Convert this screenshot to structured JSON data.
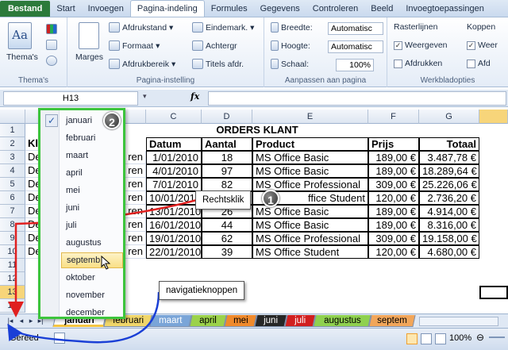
{
  "ribbon_tabs": [
    "Bestand",
    "Start",
    "Invoegen",
    "Pagina-indeling",
    "Formules",
    "Gegevens",
    "Controleren",
    "Beeld",
    "Invoegtoepassingen"
  ],
  "ribbon": {
    "themas": {
      "label": "Thema's",
      "group": "Thema's"
    },
    "marges": "Marges",
    "afdrukstand": "Afdrukstand",
    "formaat": "Formaat",
    "afdrukbereik": "Afdrukbereik",
    "eindemark": "Eindemark.",
    "achtergr": "Achtergr",
    "titels": "Titels afdr.",
    "pagina_group": "Pagina-instelling",
    "breedte_label": "Breedte:",
    "breedte_value": "Automatisc",
    "hoogte_label": "Hoogte:",
    "hoogte_value": "Automatisc",
    "schaal_label": "Schaal:",
    "schaal_value": "100%",
    "aanpassen_group": "Aanpassen aan pagina",
    "rasterlijnen": "Rasterlijnen",
    "koppen": "Koppen",
    "weergeven": "Weergeven",
    "weergeven2": "Weer",
    "afdrukken": "Afdrukken",
    "afdrukken2": "Afd",
    "werkblad_group": "Werkbladopties"
  },
  "formula_bar": {
    "name_box": "H13",
    "fx": "fx",
    "content": ""
  },
  "columns": [
    "A",
    "B",
    "C",
    "D",
    "E",
    "F",
    "G"
  ],
  "rows": [
    "1",
    "2",
    "3",
    "4",
    "5",
    "6",
    "7",
    "8",
    "9",
    "10",
    "11",
    "12",
    "13",
    "14"
  ],
  "sheet": {
    "title": "ORDERS KLANT",
    "headers": {
      "klant": "Kl",
      "datum": "Datum",
      "aantal": "Aantal",
      "product": "Product",
      "prijs": "Prijs",
      "totaal": "Totaal"
    },
    "data_rows": [
      {
        "a": "De",
        "b": "ren",
        "datum": "1/01/2010",
        "aantal": "18",
        "product": "MS Office Basic",
        "prijs": "189,00 €",
        "totaal": "3.487,78 €"
      },
      {
        "a": "De",
        "b": "ren",
        "datum": "4/01/2010",
        "aantal": "97",
        "product": "MS Office Basic",
        "prijs": "189,00 €",
        "totaal": "18.289,64 €"
      },
      {
        "a": "De",
        "b": "ren",
        "datum": "7/01/2010",
        "aantal": "82",
        "product": "MS Office Professional",
        "prijs": "309,00 €",
        "totaal": "25.226,06 €"
      },
      {
        "a": "De",
        "b": "ren",
        "datum": "10/01/2010",
        "aantal": "",
        "product": "ffice Student",
        "prijs": "120,00 €",
        "totaal": "2.736,20 €"
      },
      {
        "a": "De",
        "b": "ren",
        "datum": "13/01/2010",
        "aantal": "26",
        "product": "MS Office Basic",
        "prijs": "189,00 €",
        "totaal": "4.914,00 €"
      },
      {
        "a": "De",
        "b": "ren",
        "datum": "16/01/2010",
        "aantal": "44",
        "product": "MS Office Basic",
        "prijs": "189,00 €",
        "totaal": "8.316,00 €"
      },
      {
        "a": "De",
        "b": "ren",
        "datum": "19/01/2010",
        "aantal": "62",
        "product": "MS Office Professional",
        "prijs": "309,00 €",
        "totaal": "19.158,00 €"
      },
      {
        "a": "De",
        "b": "ren",
        "datum": "22/01/2010",
        "aantal": "39",
        "product": "MS Office Student",
        "prijs": "120,00 €",
        "totaal": "4.680,00 €"
      }
    ]
  },
  "sheet_tabs": [
    {
      "label": "januari",
      "color": "#f5c542",
      "active": true
    },
    {
      "label": "februari",
      "color": "#f0d66a"
    },
    {
      "label": "maart",
      "color": "#7aa5d8"
    },
    {
      "label": "april",
      "color": "#9bd24b"
    },
    {
      "label": "mei",
      "color": "#f08a2c"
    },
    {
      "label": "juni",
      "color": "#262626"
    },
    {
      "label": "juli",
      "color": "#d11f1f"
    },
    {
      "label": "augustus",
      "color": "#8fd14f"
    },
    {
      "label": "septem",
      "color": "#f2a65a"
    }
  ],
  "status": {
    "ready": "Gereed",
    "zoom": "100%"
  },
  "month_menu": {
    "checked": "✓",
    "items": [
      "januari",
      "februari",
      "maart",
      "april",
      "mei",
      "juni",
      "juli",
      "augustus",
      "september",
      "oktober",
      "november",
      "december"
    ],
    "hover_label": "septemb"
  },
  "annotations": {
    "badge1": "1",
    "badge2": "2",
    "rechtsklik": "Rechtsklik",
    "navigatie": "navigatieknoppen"
  },
  "colors": {
    "accent_green": "#3cc43c",
    "arrow_red": "#e02020",
    "arrow_blue": "#1a3fd6",
    "file_tab": "#2c7a3b"
  }
}
